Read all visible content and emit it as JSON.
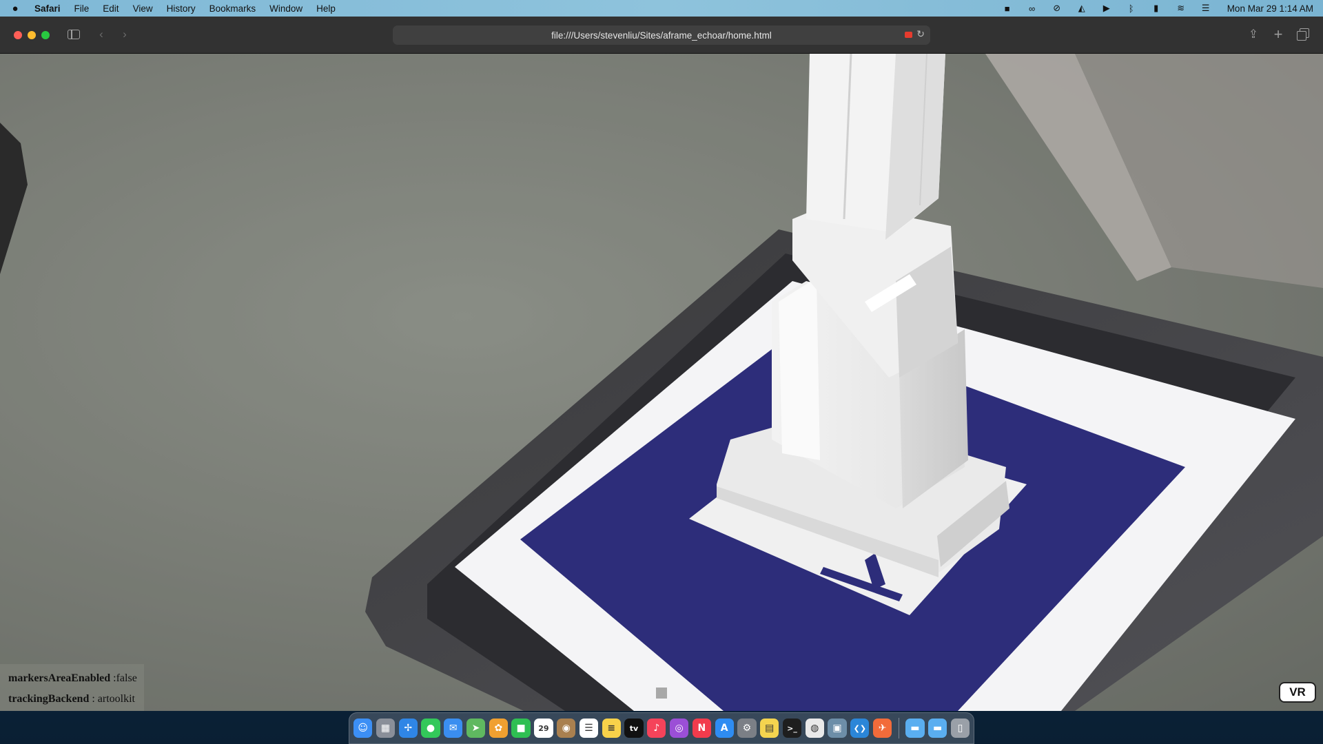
{
  "menubar": {
    "app_name": "Safari",
    "menus": [
      "File",
      "Edit",
      "View",
      "History",
      "Bookmarks",
      "Window",
      "Help"
    ],
    "clock": "Mon Mar 29  1:14 AM",
    "status_icons": [
      "video-camera-icon",
      "creative-cloud-icon",
      "sync-icon",
      "adobe-icon",
      "play-icon",
      "bluetooth-icon",
      "battery-icon",
      "wifi-icon",
      "control-center-icon"
    ]
  },
  "browser": {
    "url": "file:///Users/stevenliu/Sites/aframe_echoar/home.html"
  },
  "ar": {
    "debug": [
      {
        "key": "markersAreaEnabled",
        "value": " :false"
      },
      {
        "key": "trackingBackend",
        "value": " : artoolkit"
      }
    ],
    "vr_label": "VR"
  },
  "dock": {
    "apps": [
      {
        "name": "finder",
        "color": "#3c8ff5",
        "glyph": "☺"
      },
      {
        "name": "launchpad",
        "color": "#8a8f99",
        "glyph": "▦"
      },
      {
        "name": "safari",
        "color": "#2f86e6",
        "glyph": "✢"
      },
      {
        "name": "messages",
        "color": "#33c85a",
        "glyph": "●"
      },
      {
        "name": "mail",
        "color": "#3a8ef0",
        "glyph": "✉"
      },
      {
        "name": "maps",
        "color": "#5fb860",
        "glyph": "➤"
      },
      {
        "name": "photos",
        "color": "#f0a030",
        "glyph": "✿"
      },
      {
        "name": "facetime",
        "color": "#2fbf52",
        "glyph": "■"
      },
      {
        "name": "calendar",
        "color": "#ffffff",
        "glyph": "29"
      },
      {
        "name": "contacts",
        "color": "#a9804f",
        "glyph": "◉"
      },
      {
        "name": "reminders",
        "color": "#ffffff",
        "glyph": "☰"
      },
      {
        "name": "notes",
        "color": "#f8d24a",
        "glyph": "≡"
      },
      {
        "name": "apple-tv",
        "color": "#111111",
        "glyph": "tv"
      },
      {
        "name": "music",
        "color": "#f5435a",
        "glyph": "♪"
      },
      {
        "name": "podcasts",
        "color": "#9b4fd6",
        "glyph": "◎"
      },
      {
        "name": "news",
        "color": "#f23b4c",
        "glyph": "N"
      },
      {
        "name": "app-store",
        "color": "#2e8cf2",
        "glyph": "A"
      },
      {
        "name": "system-preferences",
        "color": "#7b7f86",
        "glyph": "⚙"
      },
      {
        "name": "stickies",
        "color": "#f4d44f",
        "glyph": "▤"
      },
      {
        "name": "terminal",
        "color": "#1e1e1e",
        "glyph": ">_"
      },
      {
        "name": "chrome",
        "color": "#e9e9e9",
        "glyph": "◍"
      },
      {
        "name": "preview",
        "color": "#6d8ea8",
        "glyph": "▣"
      },
      {
        "name": "vscode",
        "color": "#2b86d8",
        "glyph": "❮❯"
      },
      {
        "name": "swift-playgrounds",
        "color": "#f26b3a",
        "glyph": "✈"
      }
    ],
    "folders": [
      {
        "name": "downloads-folder",
        "color": "#5aaef0",
        "glyph": "▬"
      },
      {
        "name": "documents-folder",
        "color": "#5aaef0",
        "glyph": "▬"
      },
      {
        "name": "trash",
        "color": "#9aa0a8",
        "glyph": "▯"
      }
    ]
  }
}
